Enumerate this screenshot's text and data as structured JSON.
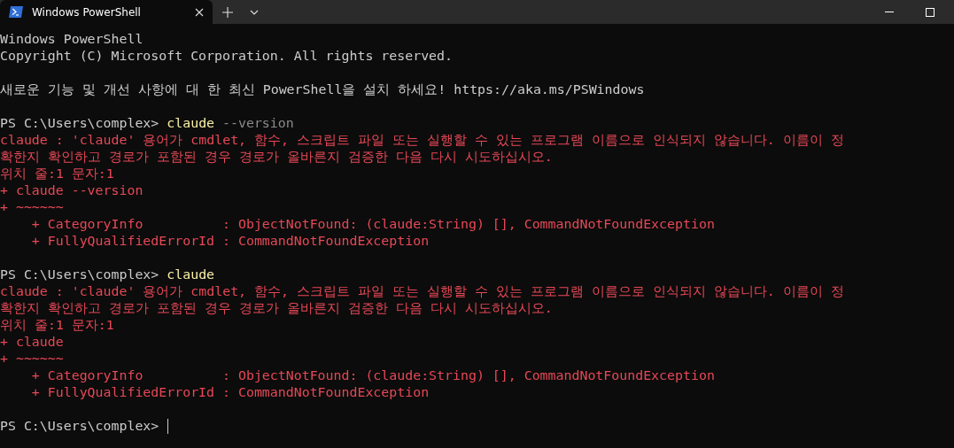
{
  "window": {
    "tabs": [
      {
        "title": "Windows PowerShell",
        "selected": true
      }
    ]
  },
  "terminal": {
    "lines": [
      {
        "segments": [
          {
            "kind": "output",
            "text": "Windows PowerShell"
          }
        ]
      },
      {
        "segments": [
          {
            "kind": "output",
            "text": "Copyright (C) Microsoft Corporation. All rights reserved."
          }
        ]
      },
      {
        "kind": "blank"
      },
      {
        "segments": [
          {
            "kind": "output",
            "text": "새로운 기능 및 개선 사항에 대 한 최신 PowerShell을 설치 하세요! https://aka.ms/PSWindows"
          }
        ]
      },
      {
        "kind": "blank"
      },
      {
        "segments": [
          {
            "kind": "prompt",
            "text": "PS C:\\Users\\complex> "
          },
          {
            "kind": "command",
            "text": "claude"
          },
          {
            "kind": "parameter",
            "text": " --version"
          }
        ]
      },
      {
        "segments": [
          {
            "kind": "error",
            "text": "claude : 'claude' 용어가 cmdlet, 함수, 스크립트 파일 또는 실행할 수 있는 프로그램 이름으로 인식되지 않습니다. 이름이 정"
          }
        ]
      },
      {
        "segments": [
          {
            "kind": "error",
            "text": "확한지 확인하고 경로가 포함된 경우 경로가 올바른지 검증한 다음 다시 시도하십시오."
          }
        ]
      },
      {
        "segments": [
          {
            "kind": "error",
            "text": "위치 줄:1 문자:1"
          }
        ]
      },
      {
        "segments": [
          {
            "kind": "error",
            "text": "+ claude --version"
          }
        ]
      },
      {
        "segments": [
          {
            "kind": "error",
            "text": "+ ~~~~~~"
          }
        ]
      },
      {
        "segments": [
          {
            "kind": "error",
            "text": "    + CategoryInfo          : ObjectNotFound: (claude:String) [], CommandNotFoundException"
          }
        ]
      },
      {
        "segments": [
          {
            "kind": "error",
            "text": "    + FullyQualifiedErrorId : CommandNotFoundException"
          }
        ]
      },
      {
        "kind": "blank"
      },
      {
        "segments": [
          {
            "kind": "prompt",
            "text": "PS C:\\Users\\complex> "
          },
          {
            "kind": "command",
            "text": "claude"
          }
        ]
      },
      {
        "segments": [
          {
            "kind": "error",
            "text": "claude : 'claude' 용어가 cmdlet, 함수, 스크립트 파일 또는 실행할 수 있는 프로그램 이름으로 인식되지 않습니다. 이름이 정"
          }
        ]
      },
      {
        "segments": [
          {
            "kind": "error",
            "text": "확한지 확인하고 경로가 포함된 경우 경로가 올바른지 검증한 다음 다시 시도하십시오."
          }
        ]
      },
      {
        "segments": [
          {
            "kind": "error",
            "text": "위치 줄:1 문자:1"
          }
        ]
      },
      {
        "segments": [
          {
            "kind": "error",
            "text": "+ claude"
          }
        ]
      },
      {
        "segments": [
          {
            "kind": "error",
            "text": "+ ~~~~~~"
          }
        ]
      },
      {
        "segments": [
          {
            "kind": "error",
            "text": "    + CategoryInfo          : ObjectNotFound: (claude:String) [], CommandNotFoundException"
          }
        ]
      },
      {
        "segments": [
          {
            "kind": "error",
            "text": "    + FullyQualifiedErrorId : CommandNotFoundException"
          }
        ]
      },
      {
        "kind": "blank"
      },
      {
        "segments": [
          {
            "kind": "prompt",
            "text": "PS C:\\Users\\complex> "
          }
        ],
        "cursor": true
      }
    ]
  }
}
